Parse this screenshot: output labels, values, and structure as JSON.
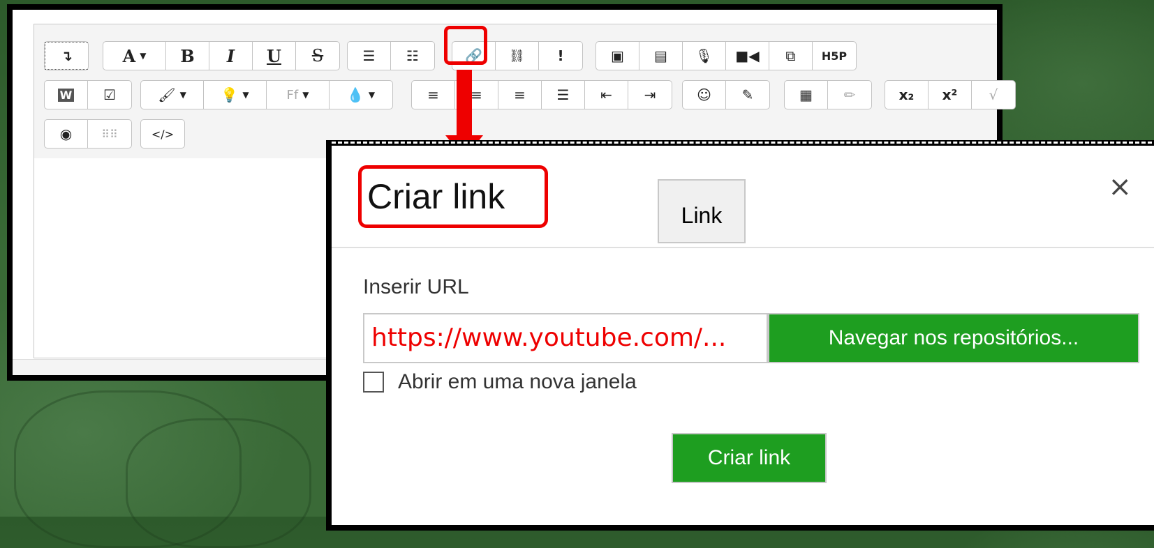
{
  "colors": {
    "highlight": "#e00000",
    "primary_button": "#1e9e20",
    "background": "#2d5a2b"
  },
  "toolbar": {
    "row1": {
      "collapse_icon": "arrow-down-icon",
      "font_color_label": "A",
      "bold_label": "B",
      "italic_label": "I",
      "underline_label": "U",
      "strike_label": "S",
      "bullet_icon": "bullet-list-icon",
      "number_icon": "numbered-list-icon",
      "link_icon": "link-icon",
      "unlink_icon": "unlink-icon",
      "exclaim_label": "!",
      "image_icon": "image-icon",
      "media_icon": "media-icon",
      "record_audio_icon": "microphone-icon",
      "record_video_icon": "video-camera-icon",
      "manage_files_icon": "copy-files-icon",
      "h5p_label": "H5P"
    },
    "row2": {
      "word_paste_label": "W",
      "checklist_icon": "checklist-icon",
      "brush_icon": "paintbrush-icon",
      "bulb_icon": "lightbulb-icon",
      "font_family_label": "Ff",
      "drop_icon": "drop-icon",
      "align_left_icon": "align-left-icon",
      "align_center_icon": "align-center-icon",
      "align_right_icon": "align-right-icon",
      "justify_icon": "justify-icon",
      "outdent_icon": "outdent-icon",
      "indent_icon": "indent-icon",
      "emoji_icon": "smiley-icon",
      "edit_icon": "pencil-square-icon",
      "table_icon": "table-icon",
      "pencil_icon": "pencil-icon",
      "subscript_label": "x₂",
      "superscript_label": "x²",
      "sqrt_label": "√"
    },
    "row3": {
      "accessibility_icon": "accessibility-icon",
      "braille_icon": "braille-icon",
      "html_label": "</>"
    }
  },
  "dialog": {
    "title": "Criar link",
    "tab_label": "Link",
    "close_label": "×",
    "url_label": "Inserir URL",
    "url_value": "https://www.youtube.com/...",
    "browse_label": "Navegar nos repositórios...",
    "new_window_label": "Abrir em uma nova janela",
    "new_window_checked": false,
    "submit_label": "Criar link"
  }
}
